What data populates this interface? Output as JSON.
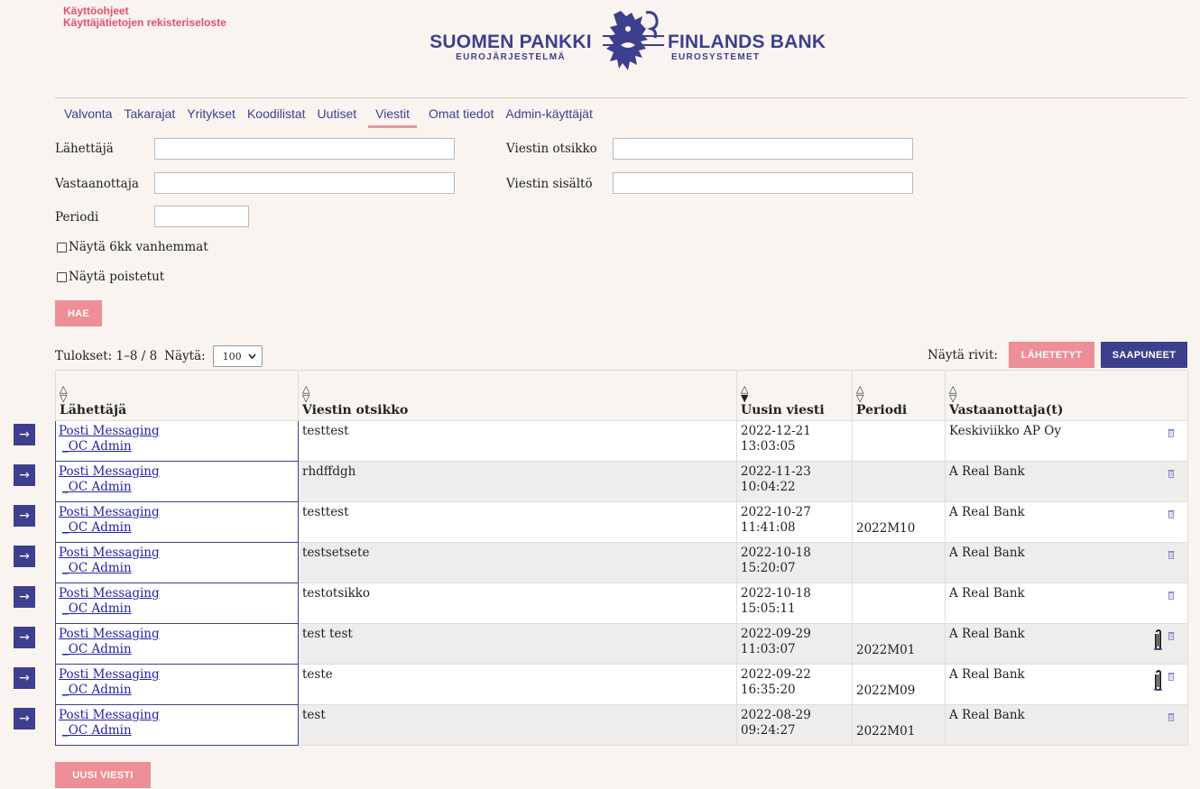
{
  "toplinks": {
    "guide": "Käyttöohjeet",
    "privacy": "Käyttäjätietojen rekisteriseloste"
  },
  "logo": {
    "left_big": "SUOMEN PANKKI",
    "left_small": "EUROJÄRJESTELMÄ",
    "right_big": "FINLANDS BANK",
    "right_small": "EUROSYSTEMET"
  },
  "nav": [
    {
      "label": "Valvonta"
    },
    {
      "label": "Takarajat"
    },
    {
      "label": "Yritykset"
    },
    {
      "label": "Koodilistat"
    },
    {
      "label": "Uutiset"
    },
    {
      "label": "Viestit",
      "active": true
    },
    {
      "label": "Omat tiedot"
    },
    {
      "label": "Admin-käyttäjät"
    }
  ],
  "form": {
    "sender_label": "Lähettäjä",
    "sender_value": "",
    "receiver_label": "Vastaanottaja",
    "receiver_value": "",
    "period_label": "Periodi",
    "period_value": "",
    "subject_label": "Viestin otsikko",
    "subject_value": "",
    "content_label": "Viestin sisältö",
    "content_value": "",
    "show_old_label": "Näytä 6kk vanhemmat",
    "show_deleted_label": "Näytä poistetut",
    "search_button": "HAE"
  },
  "results": {
    "text": "Tulokset: 1–8 / 8",
    "show_label": "Näytä:",
    "show_value": "100"
  },
  "show_rows": {
    "label": "Näytä rivit:",
    "sent_button": "LÄHETETYT",
    "received_button": "SAAPUNEET"
  },
  "table": {
    "headers": {
      "sender": "Lähettäjä",
      "subject": "Viestin otsikko",
      "latest": "Uusin viesti",
      "period": "Periodi",
      "recipients": "Vastaanottaja(t)"
    },
    "rows": [
      {
        "sender1": "Posti Messaging",
        "sender2": "_OC Admin",
        "subject": "testtest",
        "date": "2022-12-21",
        "time": "13:03:05",
        "period": "",
        "recipient": "Keskiviikko AP Oy",
        "attachment": false
      },
      {
        "sender1": "Posti Messaging",
        "sender2": "_OC Admin",
        "subject": "rhdffdgh",
        "date": "2022-11-23",
        "time": "10:04:22",
        "period": "",
        "recipient": "A Real Bank",
        "attachment": false
      },
      {
        "sender1": "Posti Messaging",
        "sender2": "_OC Admin",
        "subject": "testtest",
        "date": "2022-10-27",
        "time": "11:41:08",
        "period": "2022M10",
        "recipient": "A Real Bank",
        "attachment": false
      },
      {
        "sender1": "Posti Messaging",
        "sender2": "_OC Admin",
        "subject": "testsetsete",
        "date": "2022-10-18",
        "time": "15:20:07",
        "period": "",
        "recipient": "A Real Bank",
        "attachment": false
      },
      {
        "sender1": "Posti Messaging",
        "sender2": "_OC Admin",
        "subject": "testotsikko",
        "date": "2022-10-18",
        "time": "15:05:11",
        "period": "",
        "recipient": "A Real Bank",
        "attachment": false
      },
      {
        "sender1": "Posti Messaging",
        "sender2": "_OC Admin",
        "subject": "test test",
        "date": "2022-09-29",
        "time": "11:03:07",
        "period": "2022M01",
        "recipient": "A Real Bank",
        "attachment": true
      },
      {
        "sender1": "Posti Messaging",
        "sender2": "_OC Admin",
        "subject": "teste",
        "date": "2022-09-22",
        "time": "16:35:20",
        "period": "2022M09",
        "recipient": "A Real Bank",
        "attachment": true
      },
      {
        "sender1": "Posti Messaging",
        "sender2": "_OC Admin",
        "subject": "test",
        "date": "2022-08-29",
        "time": "09:24:27",
        "period": "2022M01",
        "recipient": "A Real Bank",
        "attachment": false
      }
    ]
  },
  "new_message_button": "UUSI VIESTI",
  "icons": {
    "row_open": "arrow-right-icon",
    "delete": "trash-icon",
    "attachment": "paperclip-icon",
    "sort": "sort-arrows-icon"
  },
  "colors": {
    "brand_blue": "#3d3f8e",
    "accent_pink": "#ee8e96",
    "link_red": "#e0506c",
    "background": "#faf4f0"
  }
}
